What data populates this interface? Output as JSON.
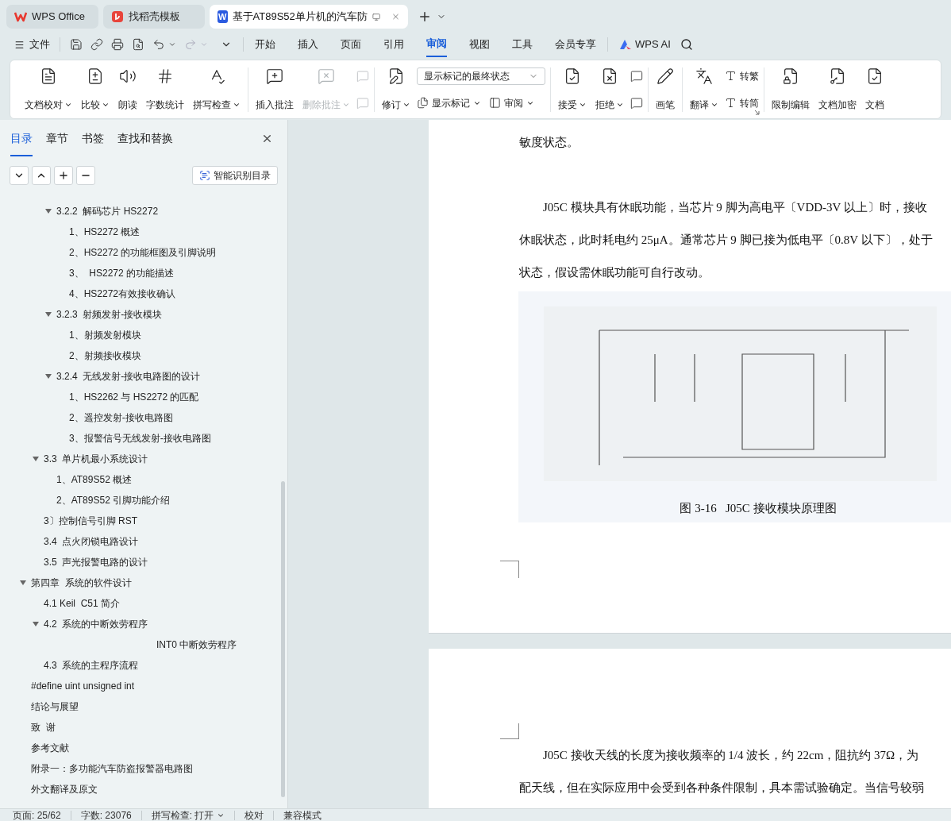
{
  "tabs": [
    {
      "label": "WPS Office",
      "kind": "home",
      "selected": false
    },
    {
      "label": "找稻壳模板",
      "kind": "template",
      "selected": false
    },
    {
      "label": "基于AT89S52单片机的汽车防",
      "kind": "document",
      "badge": "W",
      "selected": true
    }
  ],
  "file_menu": "文件",
  "menu_tabs": [
    {
      "label": "开始",
      "selected": false
    },
    {
      "label": "插入",
      "selected": false
    },
    {
      "label": "页面",
      "selected": false
    },
    {
      "label": "引用",
      "selected": false
    },
    {
      "label": "审阅",
      "selected": true
    },
    {
      "label": "视图",
      "selected": false
    },
    {
      "label": "工具",
      "selected": false
    },
    {
      "label": "会员专享",
      "selected": false
    }
  ],
  "ai_button": "WPS AI",
  "ribbon": {
    "groups": [
      {
        "items": [
          {
            "kind": "large",
            "label": "文档校对",
            "dropdown": true,
            "disabled": false
          },
          {
            "kind": "large",
            "label": "比较",
            "dropdown": true,
            "disabled": false
          },
          {
            "kind": "large",
            "label": "朗读",
            "dropdown": false,
            "disabled": false
          },
          {
            "kind": "large",
            "label": "字数统计",
            "dropdown": false,
            "disabled": false
          },
          {
            "kind": "large",
            "label": "拼写检查",
            "dropdown": true,
            "disabled": false
          }
        ]
      },
      {
        "items": [
          {
            "kind": "large",
            "label": "插入批注",
            "dropdown": false,
            "disabled": false
          },
          {
            "kind": "large",
            "label": "删除批注",
            "dropdown": true,
            "disabled": true
          },
          {
            "kind": "stack",
            "rows": [
              [
                {
                  "kind": "icon",
                  "disabled": true
                }
              ],
              [
                {
                  "kind": "icon",
                  "disabled": true
                }
              ]
            ]
          }
        ]
      },
      {
        "items": [
          {
            "kind": "large",
            "label": "修订",
            "dropdown": true,
            "disabled": false
          },
          {
            "kind": "stack",
            "rows": [
              [
                {
                  "kind": "select",
                  "value": "显示标记的最终状态"
                }
              ],
              [
                {
                  "kind": "small",
                  "label": "显示标记",
                  "dropdown": true,
                  "disabled": false
                },
                {
                  "kind": "small",
                  "label": "审阅",
                  "dropdown": true,
                  "disabled": false
                }
              ]
            ]
          }
        ]
      },
      {
        "items": [
          {
            "kind": "large",
            "label": "接受",
            "dropdown": true,
            "disabled": false
          },
          {
            "kind": "large",
            "label": "拒绝",
            "dropdown": true,
            "disabled": false
          },
          {
            "kind": "stack",
            "rows": [
              [
                {
                  "kind": "icon",
                  "disabled": false
                }
              ],
              [
                {
                  "kind": "icon",
                  "disabled": false
                }
              ]
            ]
          }
        ]
      },
      {
        "items": [
          {
            "kind": "large",
            "label": "画笔",
            "dropdown": false,
            "disabled": false
          }
        ]
      },
      {
        "launcher": true,
        "items": [
          {
            "kind": "large",
            "label": "翻译",
            "dropdown": true,
            "disabled": false
          },
          {
            "kind": "stack",
            "rows": [
              [
                {
                  "kind": "small",
                  "label": "转繁",
                  "dropdown": false,
                  "disabled": false
                }
              ],
              [
                {
                  "kind": "small",
                  "label": "转简",
                  "dropdown": false,
                  "disabled": false
                }
              ]
            ]
          }
        ]
      },
      {
        "items": [
          {
            "kind": "large",
            "label": "限制编辑",
            "dropdown": false,
            "disabled": false
          },
          {
            "kind": "large",
            "label": "文档加密",
            "dropdown": false,
            "disabled": false
          },
          {
            "kind": "large",
            "label": "文档",
            "dropdown": false,
            "disabled": false
          }
        ]
      }
    ]
  },
  "nav_panel": {
    "tabs": [
      {
        "label": "目录",
        "selected": true
      },
      {
        "label": "章节",
        "selected": false
      },
      {
        "label": "书签",
        "selected": false
      },
      {
        "label": "查找和替换",
        "selected": false
      }
    ],
    "smart_button": "智能识别目录",
    "toc": [
      {
        "children": [
          {
            "children": [
              {
                "label": "3.2.2  解码芯片 HS2272",
                "expanded": true,
                "children": [
                  {
                    "label": "1、HS2272 概述"
                  },
                  {
                    "label": "2、HS2272 的功能框图及引脚说明"
                  },
                  {
                    "label": "3、  HS2272 的功能描述"
                  },
                  {
                    "label": "4、HS2272有效接收确认"
                  }
                ]
              },
              {
                "label": "3.2.3  射频发射-接收模块",
                "expanded": true,
                "children": [
                  {
                    "label": "1、射频发射模块"
                  },
                  {
                    "label": "2、射频接收模块"
                  }
                ]
              },
              {
                "label": "3.2.4  无线发射-接收电路图的设计",
                "expanded": true,
                "children": [
                  {
                    "label": "1、HS2262 与 HS2272 的匹配"
                  },
                  {
                    "label": "2、遥控发射-接收电路图"
                  },
                  {
                    "label": "3、报警信号无线发射-接收电路图"
                  }
                ]
              }
            ]
          },
          {
            "label": "3.3  单片机最小系统设计",
            "expanded": true,
            "children": [
              {
                "label": "1、AT89S52 概述"
              },
              {
                "label": "2、AT89S52 引脚功能介绍"
              }
            ]
          },
          {
            "label": "3〕控制信号引脚 RST"
          },
          {
            "label": "3.4  点火闭锁电路设计"
          },
          {
            "label": "3.5  声光报警电路的设计"
          }
        ]
      },
      {
        "label": "第四章  系统的软件设计",
        "expanded": true,
        "children": [
          {
            "label": "4.1 Keil  C51 简介"
          },
          {
            "label": "4.2  系统的中断效劳程序",
            "expanded": true,
            "children": [
              {
                "label": "INT0 中断效劳程序",
                "kind": "centered"
              }
            ]
          },
          {
            "label": "4.3  系统的主程序流程"
          }
        ]
      },
      {
        "label": "#define uint unsigned int"
      },
      {
        "label": "结论与展望"
      },
      {
        "label": "致  谢"
      },
      {
        "label": "参考文献"
      },
      {
        "label": "附录一：多功能汽车防盗报警器电路图"
      },
      {
        "label": "外文翻译及原文"
      }
    ]
  },
  "document": {
    "page_1": {
      "lines": [
        "敏度状态。"
      ],
      "paragraph": [
        "J05C 模块具有休眠功能，当芯片 9 脚为高电平〔VDD-3V 以上〕时，接收",
        "休眠状态，此时耗电约 25μA。通常芯片 9 脚已接为低电平〔0.8V 以下〕，处于",
        "状态，假设需休眠功能可自行改动。"
      ],
      "figure_caption": "图 3-16   J05C 接收模块原理图"
    },
    "page_2": {
      "paragraph": [
        "J05C 接收天线的长度为接收频率的 1/4 波长，约 22cm，阻抗约 37Ω，为",
        "配天线，但在实际应用中会受到各种条件限制，具本需试验确定。当信号较弱"
      ]
    }
  },
  "status_bar": [
    {
      "kind": "text",
      "label": "页面: 25/62"
    },
    {
      "kind": "text",
      "label": "字数: 23076"
    },
    {
      "kind": "menu",
      "label": "拼写检查: 打开"
    },
    {
      "kind": "text",
      "label": "校对"
    },
    {
      "kind": "text",
      "label": "兼容模式"
    }
  ]
}
